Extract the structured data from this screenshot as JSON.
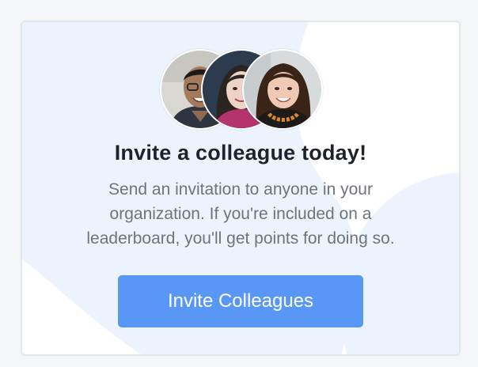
{
  "card": {
    "title": "Invite a colleague today!",
    "description": "Send an invitation to anyone in your organization. If you're included on a leaderboard, you'll get points for doing so.",
    "button_label": "Invite Colleagues",
    "avatars": [
      {
        "name": "colleague-avatar-1"
      },
      {
        "name": "colleague-avatar-2"
      },
      {
        "name": "colleague-avatar-3"
      }
    ]
  },
  "colors": {
    "page_background": "#f4f5f7",
    "card_background": "#ffffff",
    "decorative_blob": "#edf3fd",
    "button": "#5897f6",
    "title_text": "#1f2329",
    "body_text": "#6e737d"
  }
}
